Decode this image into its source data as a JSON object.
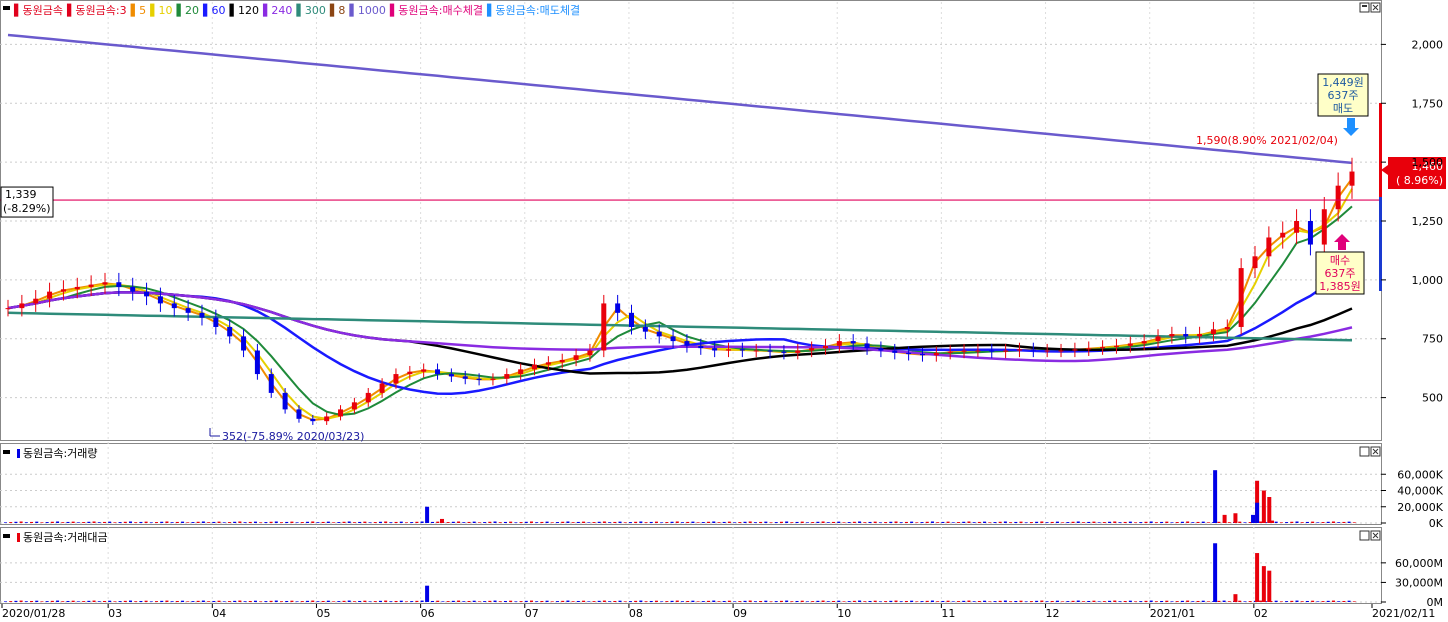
{
  "price_legend": {
    "items": [
      {
        "text": "동원금속",
        "color": "#e0001c"
      },
      {
        "text": "동원금속:3",
        "color": "#e0001c"
      },
      {
        "text": "5",
        "color": "#f08c00"
      },
      {
        "text": "10",
        "color": "#e6d000"
      },
      {
        "text": "20",
        "color": "#1f8a3a"
      },
      {
        "text": "60",
        "color": "#1a1aff"
      },
      {
        "text": "120",
        "color": "#000000"
      },
      {
        "text": "240",
        "color": "#8a2be2"
      },
      {
        "text": "300",
        "color": "#2e8b7a"
      },
      {
        "text": "8",
        "color": "#8b4513"
      },
      {
        "text": "1000",
        "color": "#6a5acd"
      },
      {
        "text": "동원금속:매수체결",
        "color": "#e0007a"
      },
      {
        "text": "동원금속:매도체결",
        "color": "#1e90ff"
      }
    ]
  },
  "volume_legend": {
    "text": "동원금속:거래량"
  },
  "amount_legend": {
    "text": "동원금속:거래대금"
  },
  "colors": {
    "up": "#e8000b",
    "down": "#0000e6",
    "ma5": "#f08c00",
    "ma10": "#e6d000",
    "ma20": "#1f8a3a",
    "ma60": "#1a1aff",
    "ma120": "#000000",
    "ma240": "#8a2be2",
    "ma300": "#2e8b7a",
    "ma1000": "#6a5acd",
    "hline": "#e0005a"
  },
  "chart_data": [
    {
      "type": "candlestick",
      "name": "동원금속",
      "ylim": [
        320,
        2180
      ],
      "y_ticks": [
        "2,000",
        "1,750",
        "1,500",
        "1,250",
        "1,000",
        "750",
        "500"
      ],
      "y_tick_values": [
        2000,
        1750,
        1500,
        1250,
        1000,
        750,
        500
      ],
      "x_date_labels": [
        "2020/01/28",
        "03",
        "04",
        "05",
        "06",
        "07",
        "08",
        "09",
        "10",
        "11",
        "12",
        "2021/01",
        "02",
        "2021/02/11"
      ],
      "current_price": {
        "text": "1,460",
        "change": "( 8.96%)",
        "value": 1460
      },
      "horizontal_line": {
        "value": 1339,
        "label": "1,339",
        "change": "(-8.29%)"
      },
      "high_annotation": {
        "text": "1,590(8.90% 2021/02/04)",
        "value": 1590
      },
      "low_annotation": {
        "text": "352(-75.89% 2020/03/23)",
        "value": 352
      },
      "sell_box": {
        "price": "1,449원",
        "qty": "637주",
        "type": "매도"
      },
      "buy_box": {
        "type": "매수",
        "qty": "637주",
        "price": "1,385원"
      },
      "close_series": [
        880,
        900,
        920,
        950,
        960,
        970,
        980,
        990,
        970,
        950,
        930,
        900,
        880,
        860,
        840,
        800,
        760,
        700,
        600,
        520,
        450,
        410,
        400,
        420,
        450,
        480,
        520,
        560,
        600,
        610,
        620,
        600,
        590,
        580,
        575,
        580,
        600,
        620,
        640,
        650,
        660,
        680,
        700,
        900,
        860,
        800,
        780,
        760,
        740,
        720,
        710,
        700,
        705,
        700,
        700,
        695,
        690,
        700,
        710,
        720,
        740,
        730,
        710,
        700,
        690,
        685,
        680,
        690,
        695,
        700,
        700,
        695,
        700,
        705,
        700,
        700,
        700,
        705,
        710,
        715,
        720,
        730,
        740,
        760,
        770,
        760,
        770,
        790,
        800,
        1050,
        1100,
        1180,
        1200,
        1250,
        1150,
        1300,
        1400,
        1460
      ]
    },
    {
      "type": "bar",
      "name": "동원금속:거래량",
      "ylim": [
        0,
        80000
      ],
      "y_ticks": [
        "60,000K",
        "40,000K",
        "20,000K",
        "0K"
      ],
      "y_tick_values": [
        60000,
        40000,
        20000,
        0
      ],
      "spikes": [
        {
          "pos": 0.311,
          "value": 20000,
          "dir": "down"
        },
        {
          "pos": 0.322,
          "value": 5000,
          "dir": "up"
        },
        {
          "pos": 0.893,
          "value": 65000,
          "dir": "down"
        },
        {
          "pos": 0.9,
          "value": 10000,
          "dir": "up"
        },
        {
          "pos": 0.908,
          "value": 12000,
          "dir": "up"
        },
        {
          "pos": 0.924,
          "value": 52000,
          "dir": "up"
        },
        {
          "pos": 0.935,
          "value": 3000,
          "dir": "up"
        },
        {
          "pos": 0.921,
          "value": 10000,
          "dir": "down"
        },
        {
          "pos": 0.924,
          "value": 25000,
          "dir": "down"
        },
        {
          "pos": 0.929,
          "value": 40000,
          "dir": "up"
        },
        {
          "pos": 0.933,
          "value": 32000,
          "dir": "up"
        }
      ]
    },
    {
      "type": "bar",
      "name": "동원금속:거래대금",
      "ylim": [
        0,
        95000
      ],
      "y_ticks": [
        "60,000M",
        "30,000M",
        "0M"
      ],
      "y_tick_values": [
        60000,
        30000,
        0
      ],
      "spikes": [
        {
          "pos": 0.311,
          "value": 25000,
          "dir": "down"
        },
        {
          "pos": 0.893,
          "value": 90000,
          "dir": "down"
        },
        {
          "pos": 0.908,
          "value": 12000,
          "dir": "up"
        },
        {
          "pos": 0.924,
          "value": 75000,
          "dir": "up"
        },
        {
          "pos": 0.929,
          "value": 55000,
          "dir": "up"
        },
        {
          "pos": 0.933,
          "value": 48000,
          "dir": "up"
        }
      ]
    }
  ]
}
